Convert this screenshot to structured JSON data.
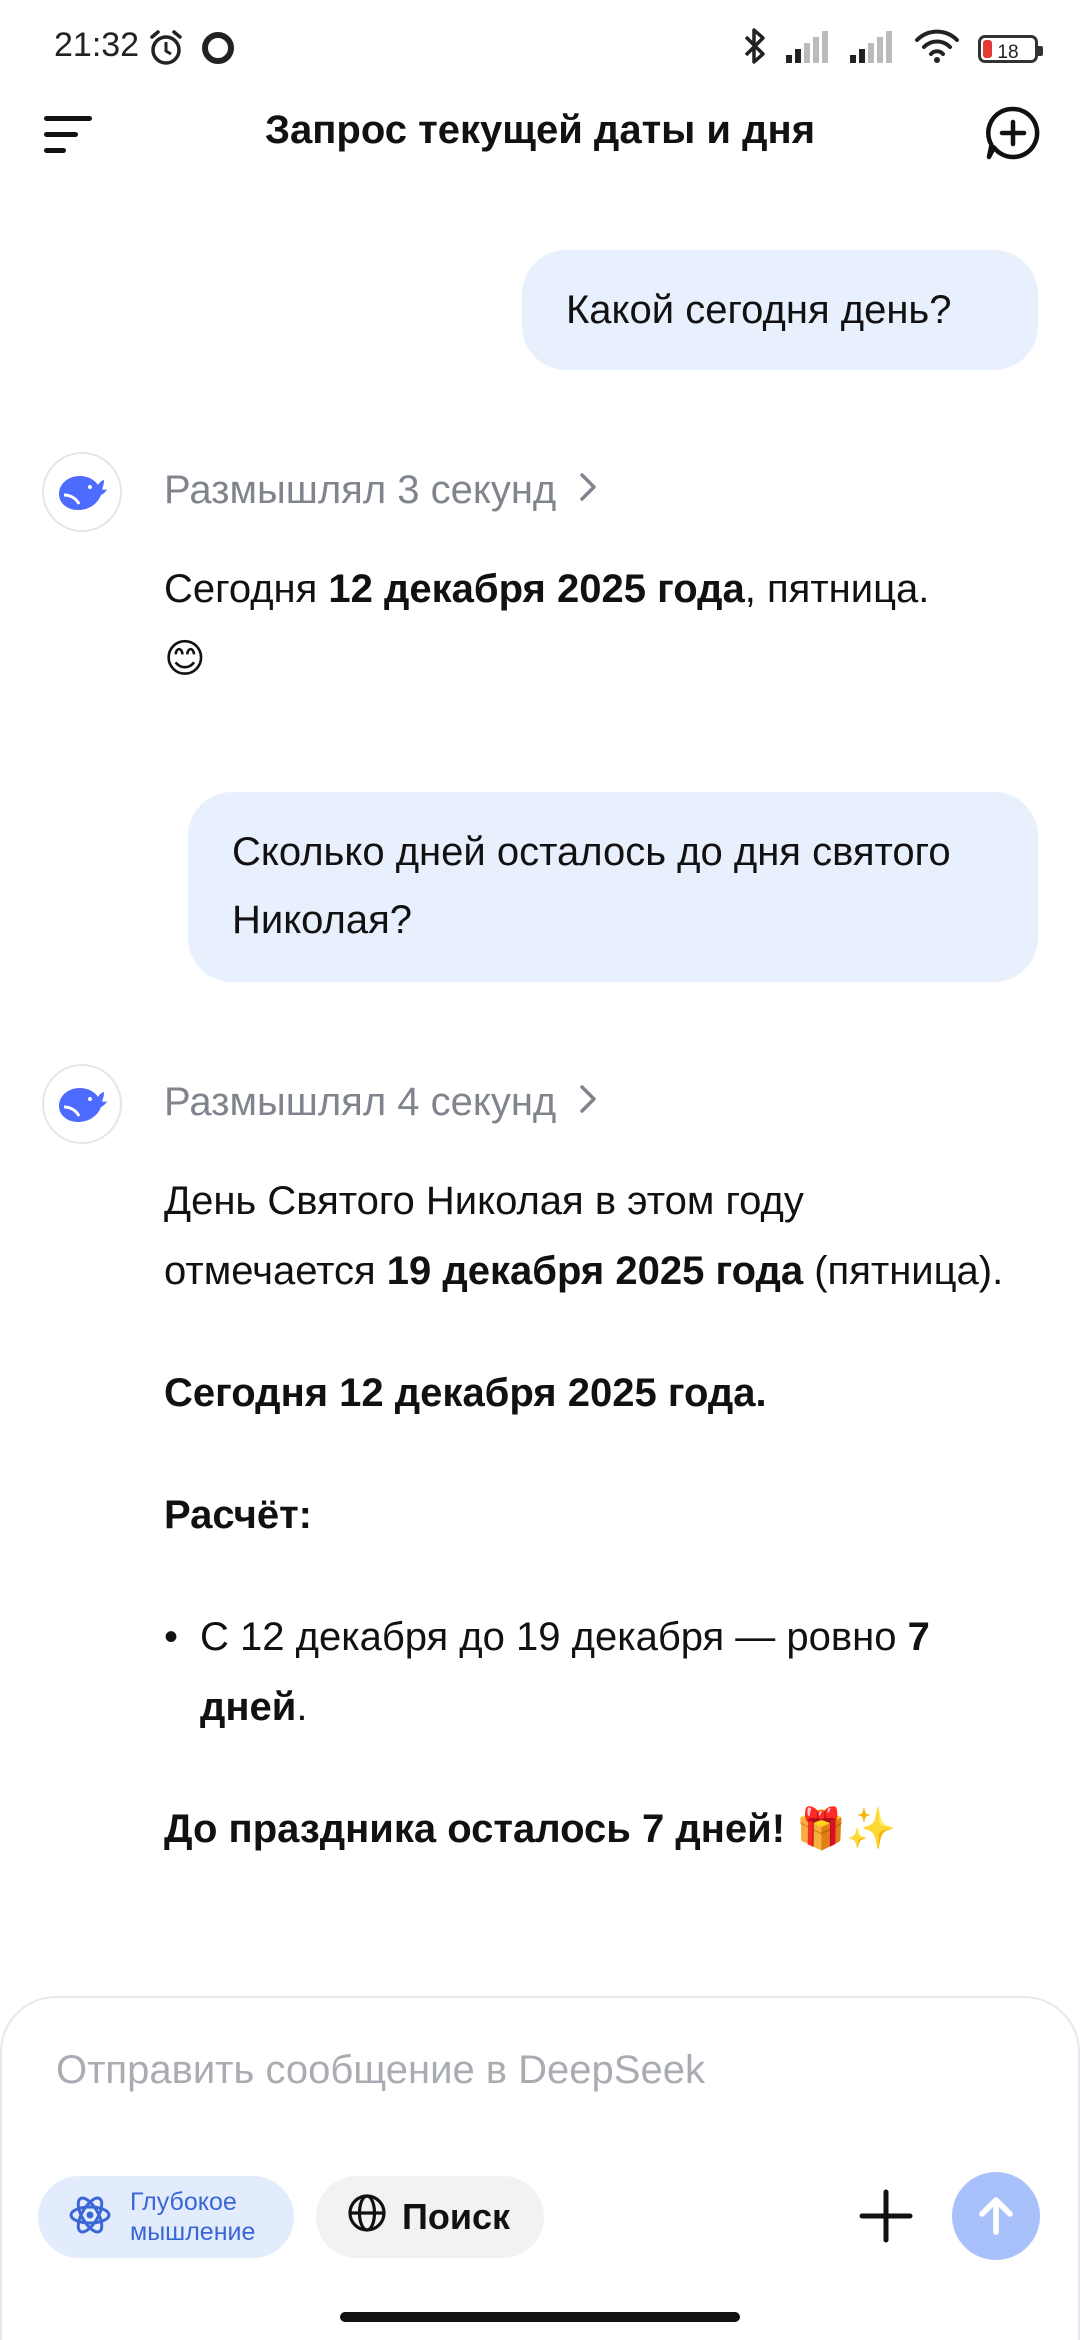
{
  "status": {
    "time": "21:32",
    "battery": "18",
    "icons": [
      "alarm-icon",
      "record-icon",
      "bluetooth-icon",
      "signal-icon",
      "signal-icon",
      "wifi-icon",
      "battery-icon"
    ],
    "battery_color": "#e53935"
  },
  "header": {
    "title": "Запрос текущей даты и дня",
    "left_icon": "menu-icon",
    "right_icon": "new-chat-icon"
  },
  "messages": {
    "user1": "Какой сегодня день?",
    "bot1": {
      "thought": "Размышлял 3 секунд",
      "p1_a": "Сегодня ",
      "p1_b": "12 декабря 2025 года",
      "p1_c": ", пятница.",
      "emoji": "😊"
    },
    "user2": "Сколько дней осталось до дня святого Николая?",
    "bot2": {
      "thought": "Размышлял 4 секунд",
      "p1_a": "День Святого Николая в этом году отмечается ",
      "p1_b": "19 декабря 2025 года",
      "p1_c": " (пятница).",
      "p2": "Сегодня 12 декабря 2025 года.",
      "p3": "Расчёт:",
      "bullet_a": "С 12 декабря до 19 декабря — ровно ",
      "bullet_b": "7 дней",
      "bullet_c": ".",
      "p4": "До праздника осталось 7 дней!",
      "p4_emoji": "🎁✨"
    }
  },
  "composer": {
    "placeholder": "Отправить сообщение в DeepSeek",
    "deep_label_1": "Глубокое",
    "deep_label_2": "мышление",
    "search_label": "Поиск"
  },
  "colors": {
    "accent": "#4d6bfe",
    "user_bubble": "#e9f0fd",
    "send_button": "#a9c1fa"
  }
}
